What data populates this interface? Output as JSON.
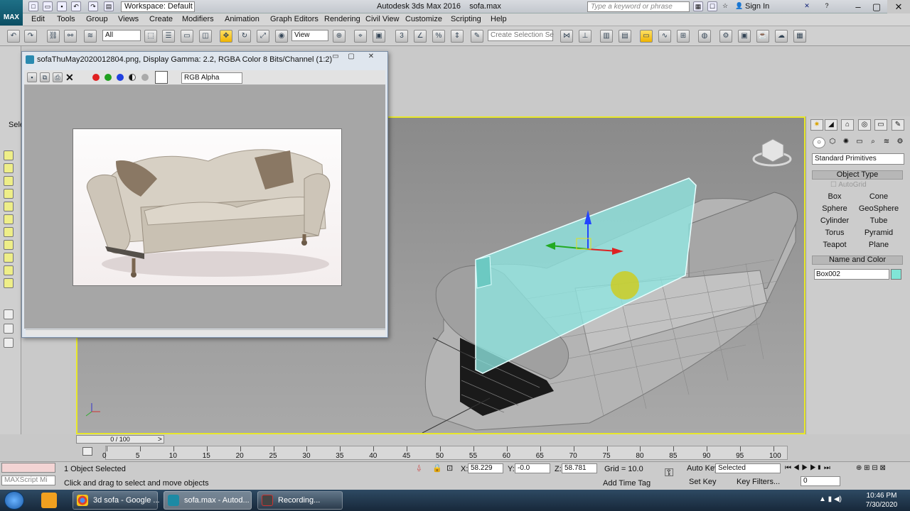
{
  "window": {
    "workspace": "Workspace: Default",
    "title": "Autodesk 3ds Max 2016",
    "file": "sofa.max",
    "search_placeholder": "Type a keyword or phrase",
    "sign_in": "Sign In"
  },
  "menu": [
    "Edit",
    "Tools",
    "Group",
    "Views",
    "Create",
    "Modifiers",
    "Animation",
    "Graph Editors",
    "Rendering",
    "Civil View",
    "Customize",
    "Scripting",
    "Help"
  ],
  "toolbar": {
    "selection_filter": "All",
    "ref_coord": "View",
    "named_selection_placeholder": "Create Selection Se"
  },
  "left_panel": {
    "select_label": "Sele"
  },
  "image_window": {
    "title": "sofaThuMay2020012804.png, Display Gamma: 2.2, RGBA Color 8 Bits/Channel (1:2)",
    "channel": "RGB Alpha"
  },
  "command_panel": {
    "category": "Standard Primitives",
    "object_type_header": "Object Type",
    "autogrid": "AutoGrid",
    "buttons": [
      "Box",
      "Cone",
      "Sphere",
      "GeoSphere",
      "Cylinder",
      "Tube",
      "Torus",
      "Pyramid",
      "Teapot",
      "Plane"
    ],
    "name_color_header": "Name and Color",
    "object_name": "Box002",
    "object_color": "#80e5d6"
  },
  "timeline": {
    "frame": "0 / 100",
    "ticks": [
      "0",
      "5",
      "10",
      "15",
      "20",
      "25",
      "30",
      "35",
      "40",
      "45",
      "50",
      "55",
      "60",
      "65",
      "70",
      "75",
      "80",
      "85",
      "90",
      "95",
      "100"
    ]
  },
  "status": {
    "maxscript": "MAXScript Mi",
    "selected_count": "1 Object Selected",
    "prompt": "Click and drag to select and move objects",
    "x_label": "X:",
    "x": "58.229",
    "y_label": "Y:",
    "y": "-0.0",
    "z_label": "Z:",
    "z": "58.781",
    "grid": "Grid = 10.0",
    "auto_key": "Auto Key",
    "set_key": "Set Key",
    "key_mode": "Selected",
    "add_time_tag": "Add Time Tag",
    "key_filters": "Key Filters...",
    "current_frame": "0"
  },
  "taskbar": {
    "items": [
      "3d sofa - Google ...",
      "sofa.max - Autod...",
      "Recording..."
    ],
    "time": "10:46 PM",
    "date": "7/30/2020"
  }
}
